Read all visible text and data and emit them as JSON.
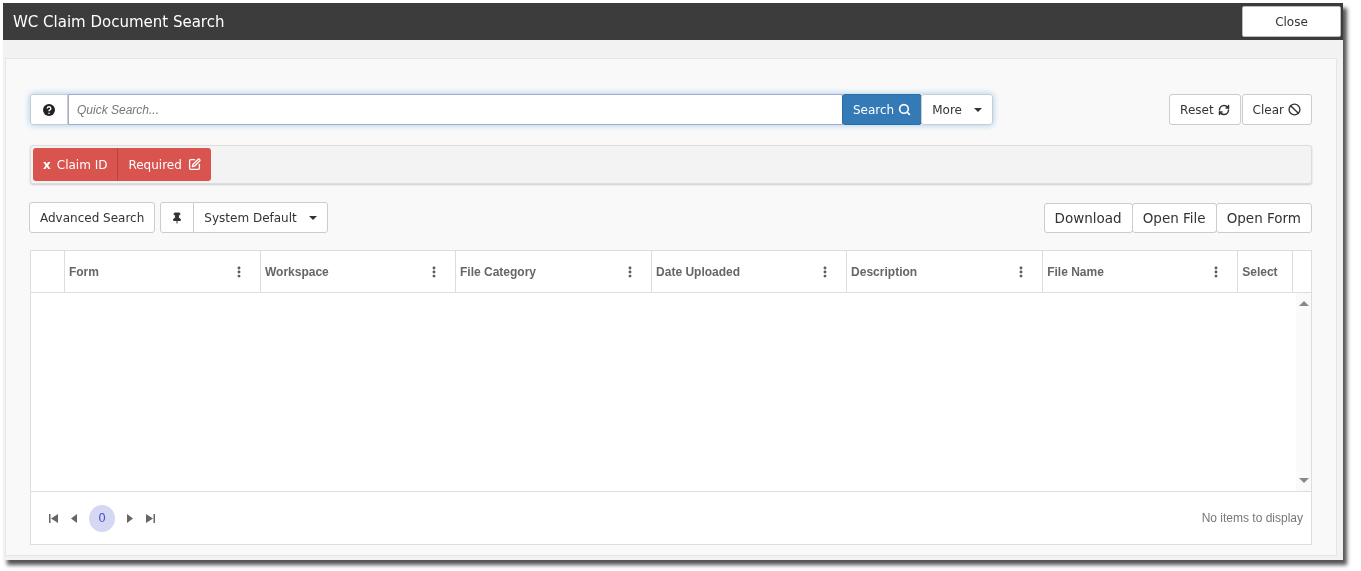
{
  "window": {
    "title": "WC Claim Document Search",
    "close_button": "Close"
  },
  "search": {
    "placeholder": "Quick Search...",
    "search_button": "Search",
    "more_button": "More",
    "reset_button": "Reset",
    "clear_button": "Clear"
  },
  "filters": [
    {
      "remove": "x",
      "field": "Claim ID",
      "value": "Required"
    }
  ],
  "toolbar": {
    "advanced_search": "Advanced Search",
    "view": "System Default",
    "actions": [
      "Download",
      "Open File",
      "Open Form"
    ]
  },
  "table": {
    "columns": [
      {
        "label": "Form",
        "menu": true
      },
      {
        "label": "Workspace",
        "menu": true
      },
      {
        "label": "File Category",
        "menu": true
      },
      {
        "label": "Date Uploaded",
        "menu": true
      },
      {
        "label": "Description",
        "menu": true
      },
      {
        "label": "File Name",
        "menu": true
      },
      {
        "label": "Select",
        "menu": false
      }
    ]
  },
  "pager": {
    "pages": [
      {
        "label": "0",
        "selected": true
      }
    ],
    "status": "No items to display"
  }
}
